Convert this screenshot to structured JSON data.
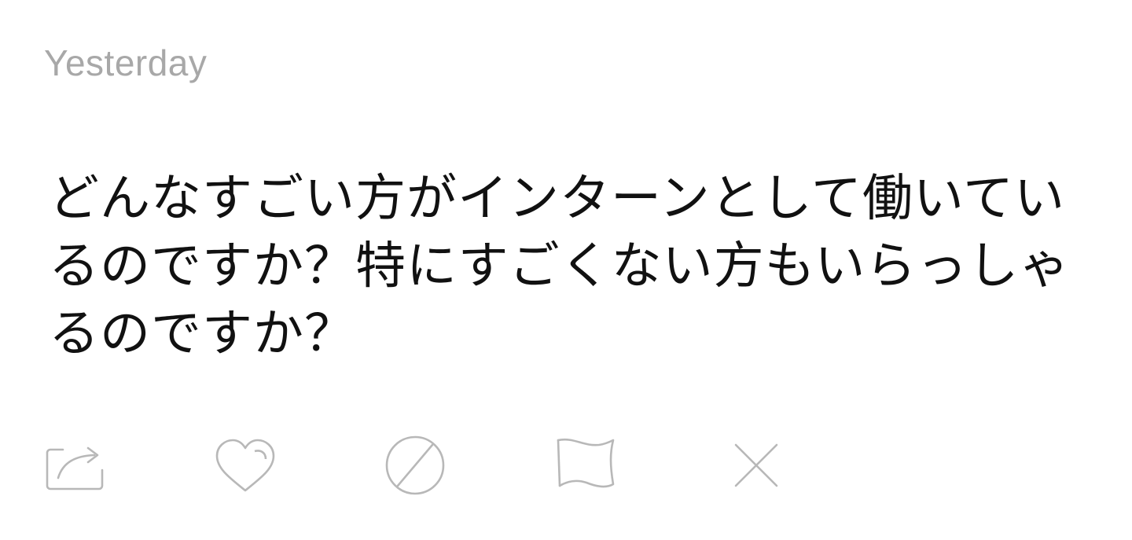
{
  "post": {
    "timestamp": "Yesterday",
    "question": "どんなすごい方がインターンとして働いているのですか？特にすごくない方もいらっしゃるのですか？"
  },
  "actions": [
    {
      "icon": "share-icon"
    },
    {
      "icon": "heart-icon"
    },
    {
      "icon": "block-icon"
    },
    {
      "icon": "flag-icon"
    },
    {
      "icon": "close-icon"
    }
  ],
  "colors": {
    "icon": "#b8b8b8",
    "timestamp": "#a8a8a8",
    "text": "#111111"
  }
}
